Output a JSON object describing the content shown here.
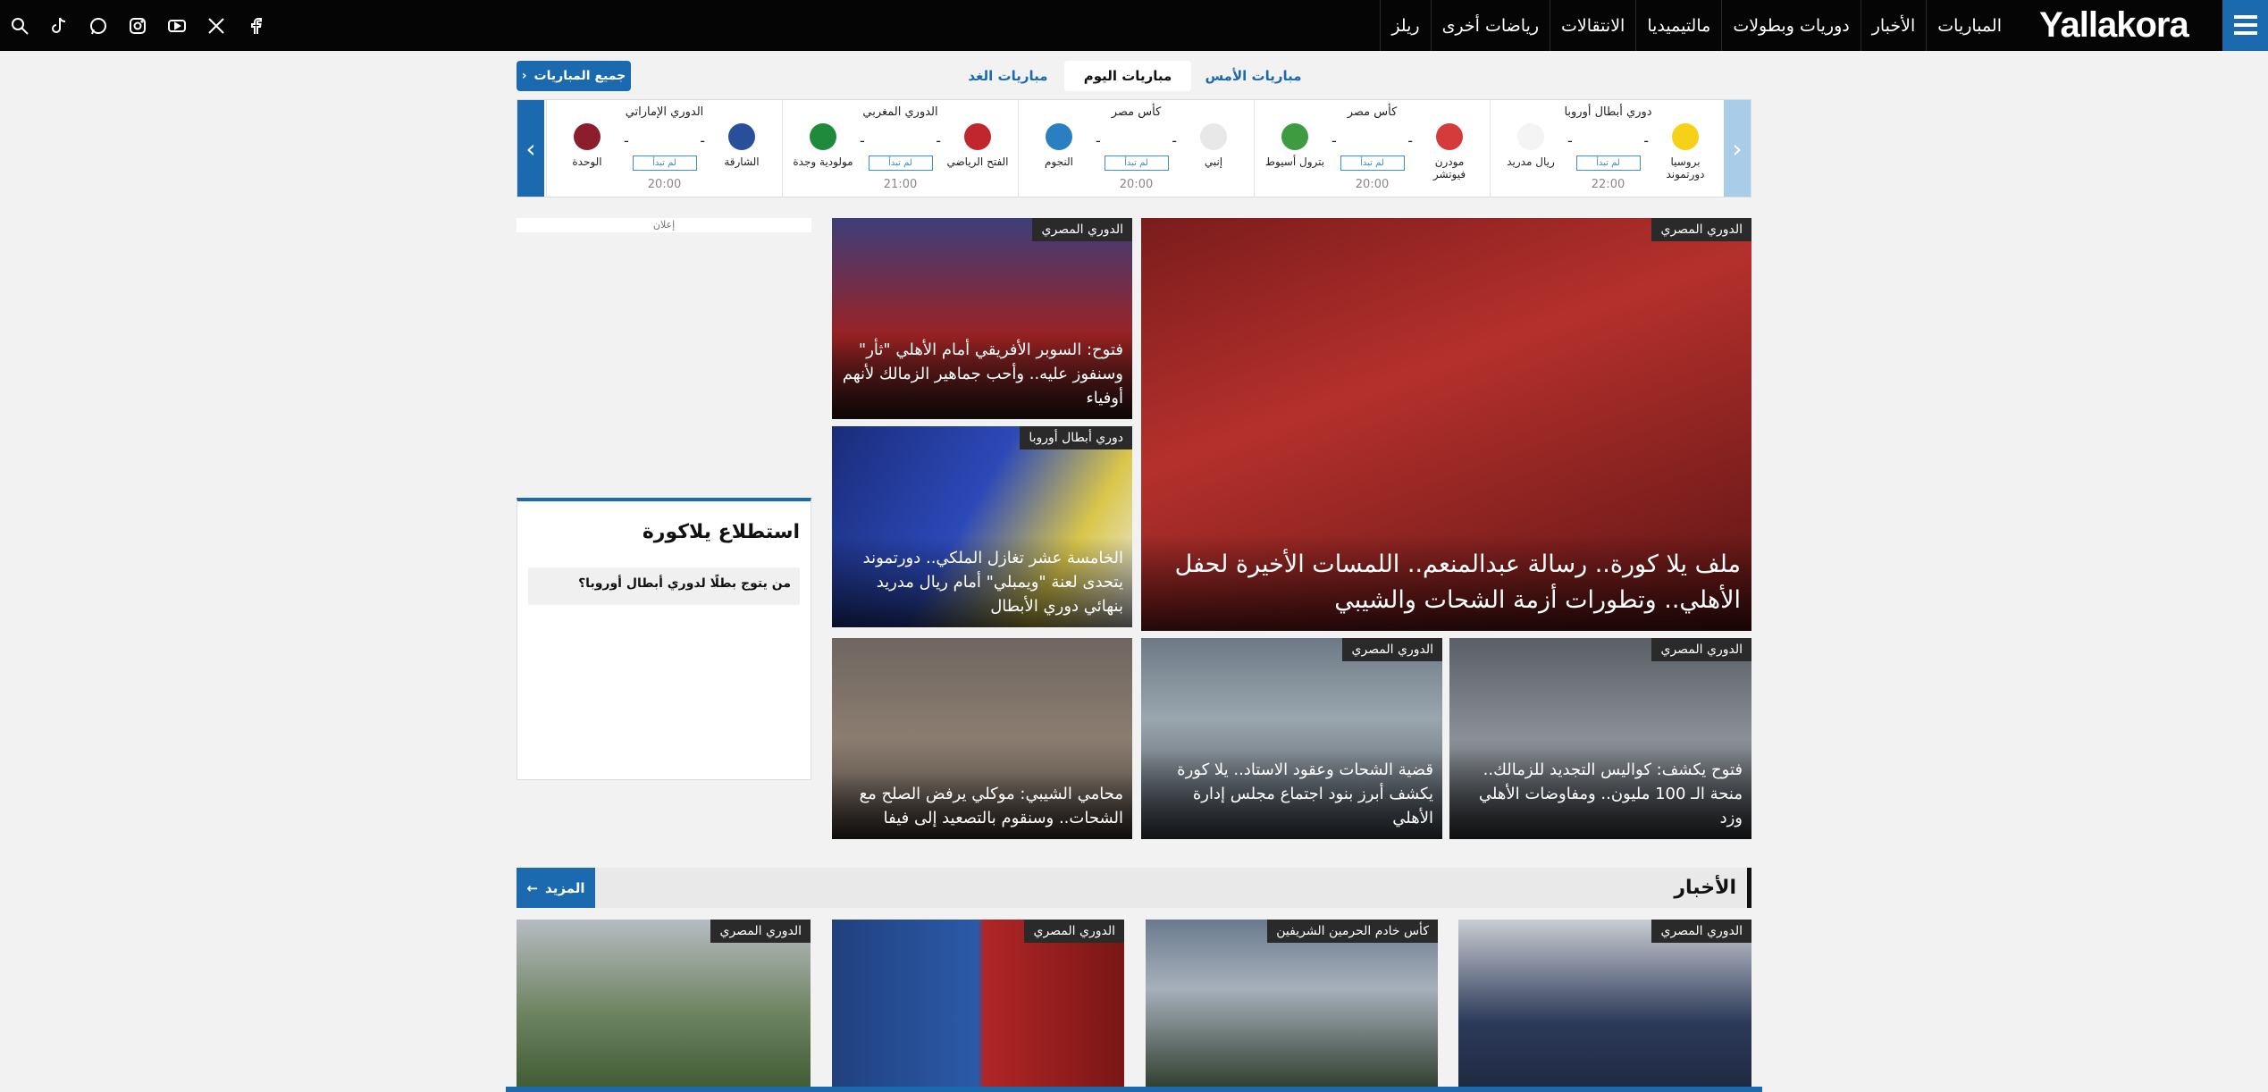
{
  "nav": {
    "logo": "Yallakora",
    "items": [
      "المباريات",
      "الأخبار",
      "دوريات وبطولات",
      "مالتيميديا",
      "الانتقالات",
      "رياضات أخرى",
      "ريلز"
    ],
    "socials": [
      "facebook-icon",
      "x-icon",
      "youtube-icon",
      "instagram-icon",
      "whatsapp-icon",
      "tiktok-icon",
      "search-icon"
    ]
  },
  "date_tabs": {
    "yesterday": "مباريات الأمس",
    "today": "مباريات اليوم",
    "tomorrow": "مباريات الغد",
    "all_matches": "جميع المباريات"
  },
  "matches": [
    {
      "league": "دوري أبطال أوروبا",
      "home": "بروسيا دورتموند",
      "away": "ريال مدريد",
      "home_score": "-",
      "away_score": "-",
      "status": "لم تبدأ",
      "time": "22:00",
      "home_color": "#f7d117",
      "away_color": "#f4f4f4"
    },
    {
      "league": "كأس مصر",
      "home": "مودرن فيوتشر",
      "away": "بترول أسيوط",
      "home_score": "-",
      "away_score": "-",
      "status": "لم تبدأ",
      "time": "20:00",
      "home_color": "#d63b3b",
      "away_color": "#3f9b3f"
    },
    {
      "league": "كأس مصر",
      "home": "إنبي",
      "away": "النجوم",
      "home_score": "-",
      "away_score": "-",
      "status": "لم تبدأ",
      "time": "20:00",
      "home_color": "#e8e8e8",
      "away_color": "#2a7fc0"
    },
    {
      "league": "الدوري المغربي",
      "home": "الفتح الرياضي",
      "away": "مولودية وجدة",
      "home_score": "-",
      "away_score": "-",
      "status": "لم تبدأ",
      "time": "21:00",
      "home_color": "#c0272d",
      "away_color": "#1f8a3b"
    },
    {
      "league": "الدوري الإماراتي",
      "home": "الشارقة",
      "away": "الوحدة",
      "home_score": "-",
      "away_score": "-",
      "status": "لم تبدأ",
      "time": "20:00",
      "home_color": "#2a4f9a",
      "away_color": "#8b1d2c"
    }
  ],
  "ad_label": "إعلان",
  "poll": {
    "title": "استطلاع يلاكورة",
    "question": "من يتوج بطلًا لدوري أبطال أوروبا؟"
  },
  "featured": {
    "main": {
      "tag": "الدوري المصري",
      "caption": "ملف يلا كورة.. رسالة عبدالمنعم.. اللمسات الأخيرة لحفل الأهلي.. وتطورات أزمة الشحات والشيبي"
    },
    "side1": {
      "tag": "الدوري المصري",
      "caption": "فتوح: السوبر الأفريقي أمام الأهلي \"ثأر\" وسنفوز عليه.. وأحب جماهير الزمالك لأنهم أوفياء"
    },
    "side2": {
      "tag": "دوري أبطال أوروبا",
      "caption": "الخامسة عشر تغازل الملكي.. دورتموند يتحدى لعنة \"ويمبلي\" أمام ريال مدريد بنهائي دوري الأبطال"
    },
    "row1": {
      "tag": "الدوري المصري",
      "caption": "فتوح يكشف: كواليس التجديد للزمالك.. منحة الـ 100 مليون.. ومفاوضات الأهلي وزد"
    },
    "row2": {
      "tag": "الدوري المصري",
      "caption": "قضية الشحات وعقود الاستاد.. يلا كورة يكشف أبرز بنود اجتماع مجلس إدارة الأهلي"
    },
    "row3": {
      "tag": "",
      "caption": "محامي الشيبي: موكلي يرفض الصلح مع الشحات.. وسنقوم بالتصعيد إلى فيفا"
    }
  },
  "news": {
    "title": "الأخبار",
    "more": "المزيد",
    "cards": [
      {
        "tag": "الدوري المصري"
      },
      {
        "tag": "كأس خادم الحرمين الشريفين"
      },
      {
        "tag": "الدوري المصري"
      },
      {
        "tag": "الدوري المصري"
      }
    ]
  },
  "colors": {
    "brand_blue": "#1b6ab0",
    "nav_bg": "#050505",
    "page_bg": "#f2f2f2"
  }
}
